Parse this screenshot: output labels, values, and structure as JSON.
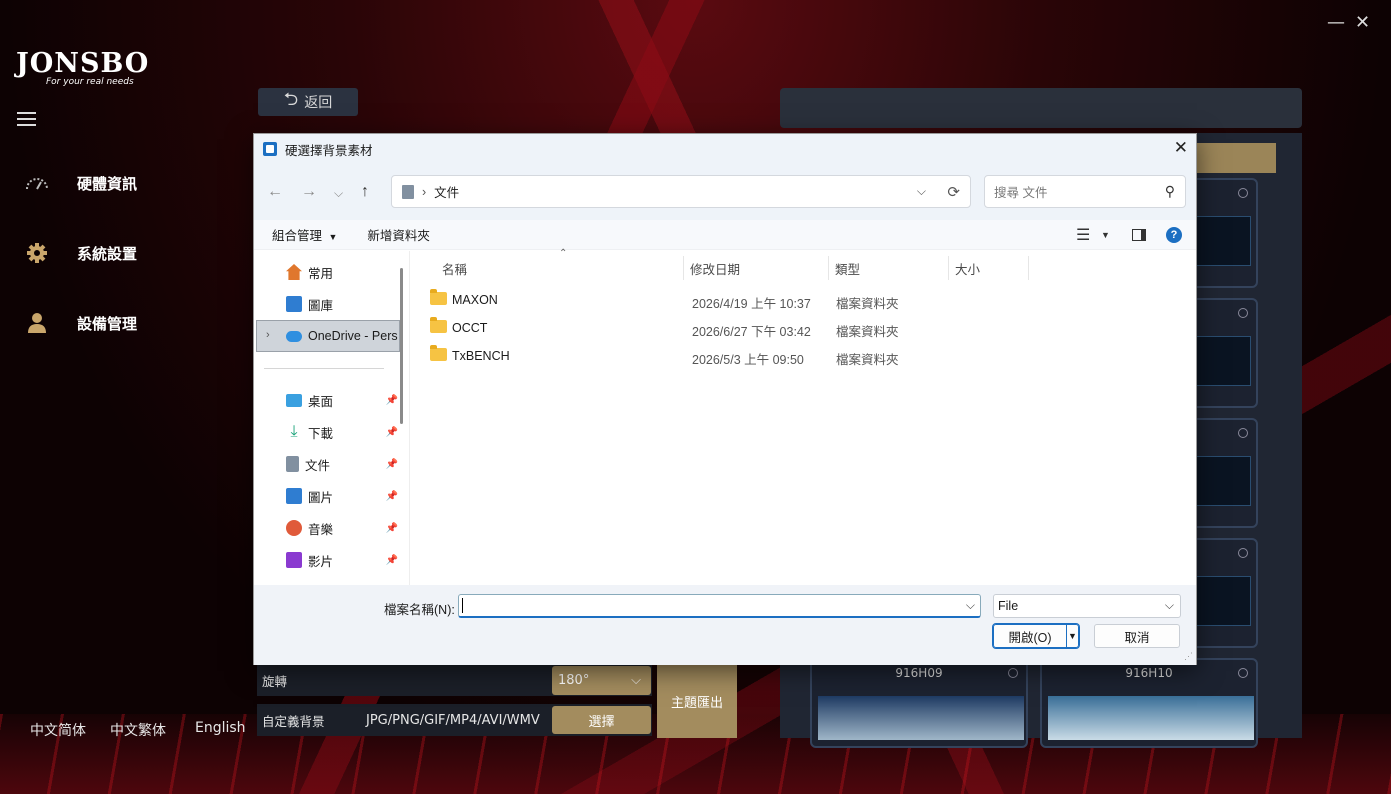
{
  "window_controls": {
    "minimize": "—",
    "close": "✕"
  },
  "logo": {
    "brand": "JONSBO",
    "tagline": "For your real needs"
  },
  "sidebar": {
    "items": [
      {
        "label": "硬體資訊",
        "icon": "speedometer-icon"
      },
      {
        "label": "系統設置",
        "icon": "gear-icon"
      },
      {
        "label": "設備管理",
        "icon": "user-icon"
      }
    ],
    "languages": [
      "中文简体",
      "中文繁体",
      "English"
    ]
  },
  "main": {
    "back_label": "返回",
    "rotation_label": "旋轉",
    "rotation_value": "180°",
    "custom_bg_label": "自定義背景",
    "custom_bg_formats": "JPG/PNG/GIF/MP4/AVI/WMV",
    "select_label": "選擇",
    "export_label": "主題匯出",
    "theme_cards": [
      {
        "name": "916H09"
      },
      {
        "name": "916H10"
      }
    ]
  },
  "dialog": {
    "title": "硬選擇背景素材",
    "address_path": "文件",
    "search_placeholder": "搜尋 文件",
    "cmd": {
      "organize": "組合管理",
      "new_folder": "新增資料夾"
    },
    "nav": {
      "quick": [
        {
          "label": "常用",
          "icon": "home-icon",
          "color": "#e0772d"
        },
        {
          "label": "圖庫",
          "icon": "gallery-icon",
          "color": "#2f7dd1"
        },
        {
          "label": "OneDrive - Pers",
          "icon": "onedrive-icon",
          "color": "#2f8fe0"
        }
      ],
      "pinned": [
        {
          "label": "桌面",
          "icon": "desktop-icon",
          "color": "#3aa0e0"
        },
        {
          "label": "下載",
          "icon": "download-icon",
          "color": "#1aa37a"
        },
        {
          "label": "文件",
          "icon": "document-icon",
          "color": "#8190a0"
        },
        {
          "label": "圖片",
          "icon": "pictures-icon",
          "color": "#2f7dd1"
        },
        {
          "label": "音樂",
          "icon": "music-icon",
          "color": "#e05a3a"
        },
        {
          "label": "影片",
          "icon": "video-icon",
          "color": "#8a3ad0"
        }
      ]
    },
    "columns": [
      "名稱",
      "修改日期",
      "類型",
      "大小"
    ],
    "files": [
      {
        "name": "MAXON",
        "date": "2026/4/19 上午 10:37",
        "type": "檔案資料夾"
      },
      {
        "name": "OCCT",
        "date": "2026/6/27 下午 03:42",
        "type": "檔案資料夾"
      },
      {
        "name": "TxBENCH",
        "date": "2026/5/3 上午 09:50",
        "type": "檔案資料夾"
      }
    ],
    "filename_label": "檔案名稱(N):",
    "filename_value": "",
    "filetype_value": "File",
    "open_label": "開啟(O)",
    "cancel_label": "取消"
  }
}
